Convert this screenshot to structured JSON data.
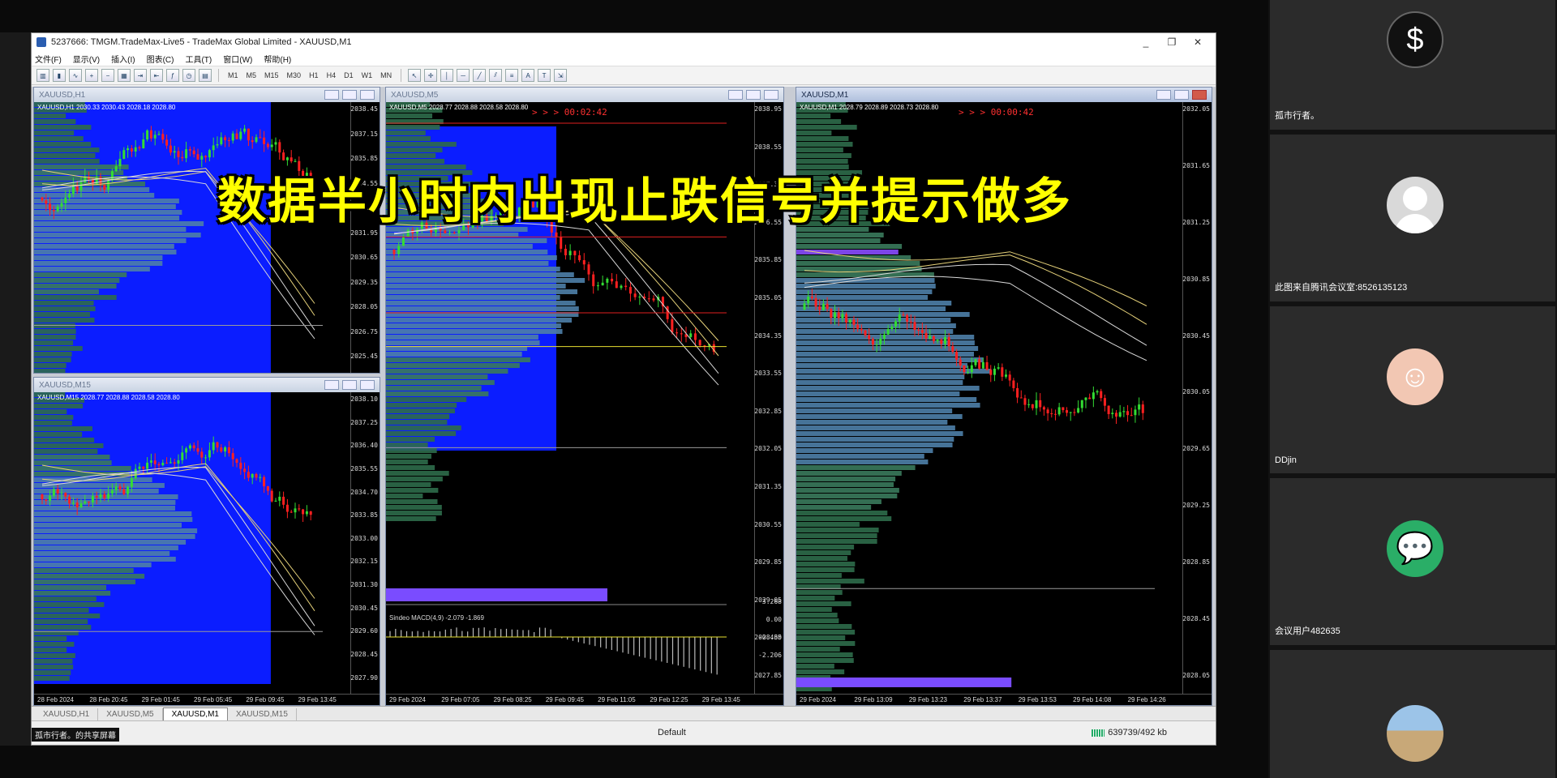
{
  "window": {
    "title": "5237666: TMGM.TradeMax-Live5 - TradeMax Global Limited - XAUUSD,M1",
    "min": "_",
    "restore": "❐",
    "close": "✕"
  },
  "menu": [
    "文件(F)",
    "显示(V)",
    "插入(I)",
    "图表(C)",
    "工具(T)",
    "窗口(W)",
    "帮助(H)"
  ],
  "toolbar": {
    "timeframes": [
      "M1",
      "M5",
      "M15",
      "M30",
      "H1",
      "H4",
      "D1",
      "W1",
      "MN"
    ]
  },
  "charts": {
    "h1": {
      "title": "XAUUSD,H1",
      "info": "XAUUSD,H1  2030.33 2030.43 2028.18 2028.80",
      "countdown": "",
      "prices": [
        "2038.45",
        "2037.15",
        "2035.85",
        "2034.55",
        "2033.25",
        "2031.95",
        "2030.65",
        "2029.35",
        "2028.05",
        "2026.75",
        "2025.45"
      ],
      "current": "2028.80",
      "times": []
    },
    "m15": {
      "title": "XAUUSD,M15",
      "info": "XAUUSD,M15  2028.77 2028.88 2028.58 2028.80",
      "prices": [
        "2038.10",
        "2037.25",
        "2036.40",
        "2035.55",
        "2034.70",
        "2033.85",
        "2033.00",
        "2032.15",
        "2031.30",
        "2030.45",
        "2029.60",
        "2028.45",
        "2027.90"
      ],
      "current": "2028.45",
      "times": [
        "28 Feb 2024",
        "28 Feb 20:45",
        "29 Feb 01:45",
        "29 Feb 05:45",
        "29 Feb 09:45",
        "29 Feb 13:45"
      ]
    },
    "m5": {
      "title": "XAUUSD,M5",
      "info": "XAUUSD,M5  2028.77 2028.88 2028.58 2028.80",
      "countdown": "> > >  00:02:42",
      "prices": [
        "2038.95",
        "2038.55",
        "2037.35",
        "2036.55",
        "2035.85",
        "2035.05",
        "2034.35",
        "2033.55",
        "2032.85",
        "2032.05",
        "2031.35",
        "2030.55",
        "2029.85",
        "2029.05",
        "2028.35",
        "2027.85"
      ],
      "current": "2028.80",
      "macd_label": "Sindeo MACD(4,9) -2.079 -1.869",
      "macd_prices": [
        "3.268",
        "0.00",
        "-0.460",
        "-2.206"
      ],
      "times": [
        "29 Feb 2024",
        "29 Feb 07:05",
        "29 Feb 08:25",
        "29 Feb 09:45",
        "29 Feb 11:05",
        "29 Feb 12:25",
        "29 Feb 13:45"
      ]
    },
    "m1": {
      "title": "XAUUSD,M1",
      "info": "XAUUSD,M1  2028.79 2028.89 2028.73 2028.80",
      "countdown": "> > >  00:00:42",
      "prices": [
        "2032.05",
        "2031.65",
        "2031.25",
        "2030.85",
        "2030.45",
        "2030.05",
        "2029.65",
        "2029.25",
        "2028.85",
        "2028.45",
        "2028.05"
      ],
      "current": "2028.80",
      "times": [
        "29 Feb 2024",
        "29 Feb 13:09",
        "29 Feb 13:23",
        "29 Feb 13:37",
        "29 Feb 13:53",
        "29 Feb 14:08",
        "29 Feb 14:26"
      ]
    }
  },
  "tabs": [
    "XAUUSD,H1",
    "XAUUSD,M5",
    "XAUUSD,M1",
    "XAUUSD,M15"
  ],
  "active_tab": "XAUUSD,M1",
  "status": {
    "share": "孤市行者。的共享屏幕",
    "profile": "Default",
    "traffic": "639739/492 kb"
  },
  "subtitle": "数据半小时内出现止跌信号并提示做多",
  "participants": [
    {
      "name": "孤市行者。",
      "avatar": "dollar"
    },
    {
      "name": "此图来自腾讯会议室:8526135123",
      "avatar": "gray"
    },
    {
      "name": "DDjin",
      "avatar": "girl"
    },
    {
      "name": "会议用户482635",
      "avatar": "wechat"
    },
    {
      "name": "",
      "avatar": "photo"
    }
  ],
  "colors": {
    "bull": "#33dd33",
    "bear": "#ff2020",
    "profile_blue": "#0b1dff",
    "subtitle": "#ffff00"
  }
}
